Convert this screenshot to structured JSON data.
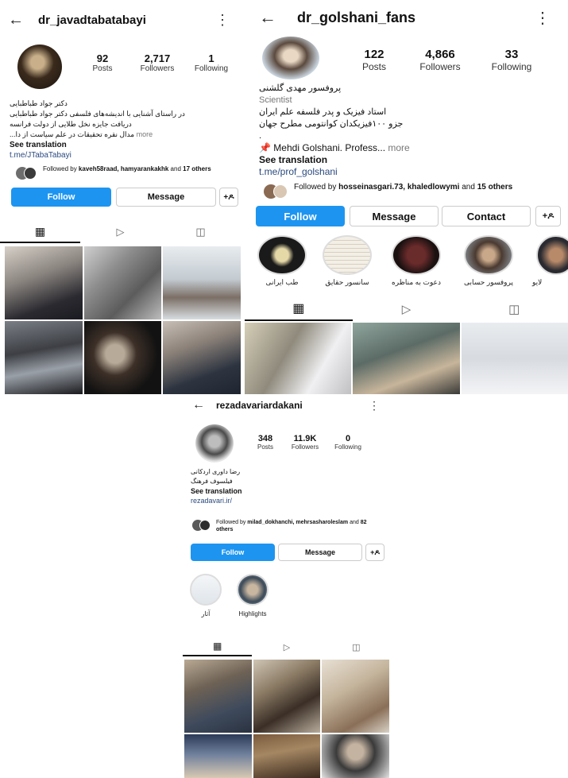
{
  "panel1": {
    "username": "dr_javadtabatabayi",
    "stats": [
      {
        "value": "92",
        "label": "Posts"
      },
      {
        "value": "2,717",
        "label": "Followers"
      },
      {
        "value": "1",
        "label": "Following"
      }
    ],
    "bio_lines": [
      "دکتر جواد طباطبایی",
      "در راستای آشنایی با اندیشه‌های فلسفی دکتر جواد طباطبایی",
      "دریافت جایزه نخل طلایی از دولت فرانسه"
    ],
    "bio_more_text": "مدال نقره تحقیقات در علم سیاست از دا...",
    "more_label": "more",
    "see_translation": "See translation",
    "link": "t.me/JTabaTabayi",
    "followed_by_prefix": "Followed by ",
    "followed_by_names": "kaveh58raad, hamyarankakhk",
    "followed_by_and": " and ",
    "followed_by_others": "17 others",
    "follow_label": "Follow",
    "message_label": "Message",
    "add_user_glyph": "+ዶ"
  },
  "panel2": {
    "username": "dr_golshani_fans",
    "stats": [
      {
        "value": "122",
        "label": "Posts"
      },
      {
        "value": "4,866",
        "label": "Followers"
      },
      {
        "value": "33",
        "label": "Following"
      }
    ],
    "name_line": "پروفسور مهدی گلشنی",
    "category": "Scientist",
    "bio_lines": [
      "استاد فیزیک و پدر فلسفه علم ایران",
      "جزو ۱۰۰فیزیکدان کوانتومی مطرح جهان"
    ],
    "dot": ".",
    "pin_text": "Mehdi Golshani. Profess...",
    "more_label": "more",
    "see_translation": "See translation",
    "link": "t.me/prof_golshani",
    "followed_by_prefix": "Followed by ",
    "followed_by_names": "hosseinasgari.73, khaledlowymi",
    "followed_by_and": " and ",
    "followed_by_others": "15 others",
    "follow_label": "Follow",
    "message_label": "Message",
    "contact_label": "Contact",
    "add_user_glyph": "+ዶ",
    "highlights": [
      "طب ایرانی",
      "سانسور حقایق",
      "دعوت به مناظره",
      "پروفسور حسابی",
      "لایو"
    ]
  },
  "panel3": {
    "username": "rezadavariardakani",
    "stats": [
      {
        "value": "348",
        "label": "Posts"
      },
      {
        "value": "11.9K",
        "label": "Followers"
      },
      {
        "value": "0",
        "label": "Following"
      }
    ],
    "bio_lines": [
      "رضا داوری اردکانی",
      "فیلسوف فرهنگ"
    ],
    "see_translation": "See translation",
    "link": "rezadavari.ir/",
    "followed_by_prefix": "Followed by ",
    "followed_by_names": "milad_dokhanchi, mehrsasharoleslam",
    "followed_by_and": " and ",
    "followed_by_others": "82 others",
    "follow_label": "Follow",
    "message_label": "Message",
    "add_user_glyph": "+ዶ",
    "highlights": [
      "آثار",
      "Highlights"
    ]
  },
  "icons": {
    "back": "←",
    "kebab": "⋮",
    "grid": "▦",
    "reels": "▷",
    "tagged": "◫",
    "pin": "📌"
  },
  "colors": {
    "follow_blue": "#1d95f0",
    "link_blue": "#2a4a7f",
    "border": "#cccccc"
  }
}
